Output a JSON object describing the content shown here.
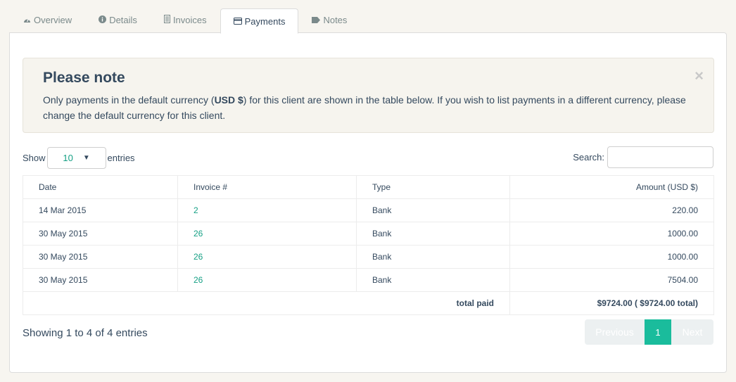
{
  "tabs": [
    {
      "label": "Overview",
      "icon": "dashboard-icon"
    },
    {
      "label": "Details",
      "icon": "info-icon"
    },
    {
      "label": "Invoices",
      "icon": "document-icon"
    },
    {
      "label": "Payments",
      "icon": "credit-card-icon"
    },
    {
      "label": "Notes",
      "icon": "tag-icon"
    }
  ],
  "alert": {
    "title": "Please note",
    "text_before": "Only payments in the default currency (",
    "currency": "USD $",
    "text_after": ") for this client are shown in the table below. If you wish to list payments in a different currency, please change the default currency for this client.",
    "close": "×"
  },
  "length": {
    "show": "Show",
    "value": "10",
    "entries": "entries"
  },
  "search": {
    "label": "Search:",
    "value": ""
  },
  "table": {
    "headers": [
      "Date",
      "Invoice #",
      "Type",
      "Amount (USD $)"
    ],
    "rows": [
      {
        "date": "14 Mar 2015",
        "invoice": "2",
        "type": "Bank",
        "amount": "220.00"
      },
      {
        "date": "30 May 2015",
        "invoice": "26",
        "type": "Bank",
        "amount": "1000.00"
      },
      {
        "date": "30 May 2015",
        "invoice": "26",
        "type": "Bank",
        "amount": "1000.00"
      },
      {
        "date": "30 May 2015",
        "invoice": "26",
        "type": "Bank",
        "amount": "7504.00"
      }
    ],
    "total_label": "total paid",
    "total_value": "$9724.00 ( $9724.00 total)"
  },
  "info": "Showing 1 to 4 of 4 entries",
  "pagination": {
    "previous": "Previous",
    "current": "1",
    "next": "Next"
  },
  "colors": {
    "accent": "#1abc9c",
    "link": "#16a085",
    "text": "#34495e"
  }
}
